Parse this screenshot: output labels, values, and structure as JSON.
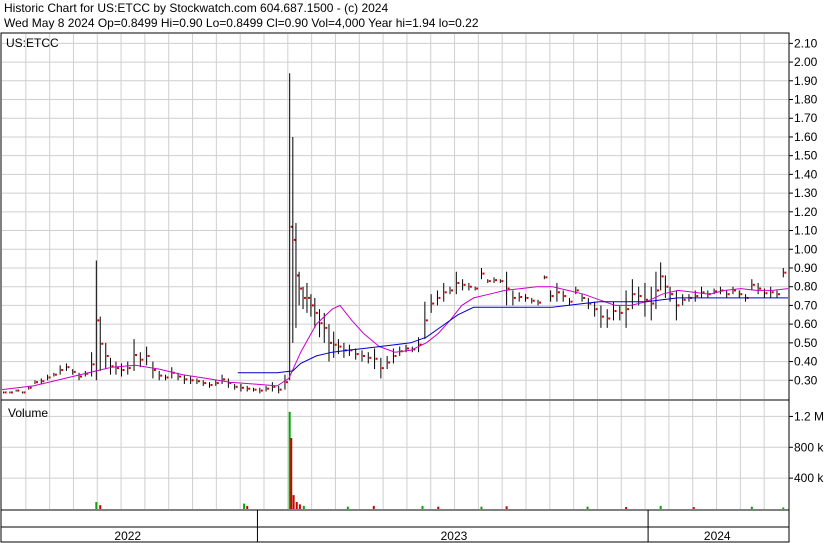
{
  "header": {
    "line1": "Historic Chart for US:ETCC by Stockwatch.com 604.687.1500 - (c) 2024",
    "line2": "Wed May  8 2024   Op=0.8499  Hi=0.90  Lo=0.8499  Cl=0.90  Vol=4,000  Year hi=1.94  lo=0.22"
  },
  "chart_data": {
    "type": "line",
    "price_panel_label": "US:ETCC",
    "volume_panel_label": "Volume",
    "price_axis": {
      "min": 0.2,
      "max": 2.15,
      "ticks": [
        "0.30",
        "0.40",
        "0.50",
        "0.60",
        "0.70",
        "0.80",
        "0.90",
        "1.00",
        "1.10",
        "1.20",
        "1.30",
        "1.40",
        "1.50",
        "1.60",
        "1.70",
        "1.80",
        "1.90",
        "2.00",
        "2.10"
      ]
    },
    "volume_axis": {
      "min": 0,
      "max": 1400000,
      "ticks": [
        {
          "v": 400000,
          "label": "400 k"
        },
        {
          "v": 800000,
          "label": "800 k"
        },
        {
          "v": 1200000,
          "label": "1.2 M"
        }
      ]
    },
    "year_labels": [
      "2022",
      "2023",
      "2024"
    ],
    "x_domain": [
      0,
      100
    ],
    "year_boundaries": [
      32.5,
      82.2
    ],
    "year_label_positions": [
      16.0,
      57.5,
      91.0
    ],
    "price_series": [
      {
        "x": 0.2,
        "h": 0.24,
        "l": 0.23
      },
      {
        "x": 1.0,
        "h": 0.24,
        "l": 0.23
      },
      {
        "x": 1.8,
        "h": 0.25,
        "l": 0.24
      },
      {
        "x": 2.6,
        "h": 0.24,
        "l": 0.23
      },
      {
        "x": 3.4,
        "h": 0.27,
        "l": 0.25
      },
      {
        "x": 4.2,
        "h": 0.3,
        "l": 0.28
      },
      {
        "x": 5.0,
        "h": 0.31,
        "l": 0.28
      },
      {
        "x": 5.8,
        "h": 0.33,
        "l": 0.3
      },
      {
        "x": 6.6,
        "h": 0.34,
        "l": 0.32
      },
      {
        "x": 7.4,
        "h": 0.38,
        "l": 0.33
      },
      {
        "x": 8.2,
        "h": 0.39,
        "l": 0.35
      },
      {
        "x": 9.0,
        "h": 0.36,
        "l": 0.33
      },
      {
        "x": 9.8,
        "h": 0.34,
        "l": 0.3
      },
      {
        "x": 10.6,
        "h": 0.35,
        "l": 0.32
      },
      {
        "x": 11.4,
        "h": 0.45,
        "l": 0.32
      },
      {
        "x": 12.0,
        "h": 0.94,
        "l": 0.3
      },
      {
        "x": 12.5,
        "h": 0.64,
        "l": 0.35
      },
      {
        "x": 13.2,
        "h": 0.5,
        "l": 0.36
      },
      {
        "x": 13.8,
        "h": 0.42,
        "l": 0.33
      },
      {
        "x": 14.5,
        "h": 0.4,
        "l": 0.33
      },
      {
        "x": 15.2,
        "h": 0.39,
        "l": 0.32
      },
      {
        "x": 16.0,
        "h": 0.4,
        "l": 0.33
      },
      {
        "x": 16.8,
        "h": 0.52,
        "l": 0.35
      },
      {
        "x": 17.6,
        "h": 0.45,
        "l": 0.37
      },
      {
        "x": 18.4,
        "h": 0.48,
        "l": 0.38
      },
      {
        "x": 19.2,
        "h": 0.4,
        "l": 0.31
      },
      {
        "x": 20.0,
        "h": 0.35,
        "l": 0.3
      },
      {
        "x": 20.8,
        "h": 0.33,
        "l": 0.3
      },
      {
        "x": 21.6,
        "h": 0.37,
        "l": 0.31
      },
      {
        "x": 22.4,
        "h": 0.34,
        "l": 0.3
      },
      {
        "x": 23.2,
        "h": 0.33,
        "l": 0.28
      },
      {
        "x": 24.0,
        "h": 0.32,
        "l": 0.28
      },
      {
        "x": 24.8,
        "h": 0.31,
        "l": 0.28
      },
      {
        "x": 25.6,
        "h": 0.3,
        "l": 0.27
      },
      {
        "x": 26.4,
        "h": 0.29,
        "l": 0.26
      },
      {
        "x": 27.2,
        "h": 0.3,
        "l": 0.27
      },
      {
        "x": 28.0,
        "h": 0.33,
        "l": 0.28
      },
      {
        "x": 28.8,
        "h": 0.31,
        "l": 0.26
      },
      {
        "x": 29.6,
        "h": 0.28,
        "l": 0.25
      },
      {
        "x": 30.4,
        "h": 0.28,
        "l": 0.24
      },
      {
        "x": 31.2,
        "h": 0.27,
        "l": 0.24
      },
      {
        "x": 32.0,
        "h": 0.26,
        "l": 0.24
      },
      {
        "x": 32.8,
        "h": 0.26,
        "l": 0.23
      },
      {
        "x": 33.6,
        "h": 0.27,
        "l": 0.24
      },
      {
        "x": 34.4,
        "h": 0.29,
        "l": 0.24
      },
      {
        "x": 35.2,
        "h": 0.27,
        "l": 0.23
      },
      {
        "x": 36.0,
        "h": 0.33,
        "l": 0.25
      },
      {
        "x": 36.6,
        "h": 1.94,
        "l": 0.3
      },
      {
        "x": 37.0,
        "h": 1.6,
        "l": 0.5
      },
      {
        "x": 37.4,
        "h": 1.14,
        "l": 0.58
      },
      {
        "x": 37.8,
        "h": 0.88,
        "l": 0.7
      },
      {
        "x": 38.3,
        "h": 0.8,
        "l": 0.68
      },
      {
        "x": 38.8,
        "h": 0.82,
        "l": 0.66
      },
      {
        "x": 39.3,
        "h": 0.76,
        "l": 0.64
      },
      {
        "x": 39.8,
        "h": 0.74,
        "l": 0.58
      },
      {
        "x": 40.4,
        "h": 0.68,
        "l": 0.53
      },
      {
        "x": 41.0,
        "h": 0.66,
        "l": 0.5
      },
      {
        "x": 41.6,
        "h": 0.6,
        "l": 0.4
      },
      {
        "x": 42.2,
        "h": 0.56,
        "l": 0.42
      },
      {
        "x": 42.8,
        "h": 0.52,
        "l": 0.44
      },
      {
        "x": 43.5,
        "h": 0.5,
        "l": 0.42
      },
      {
        "x": 44.2,
        "h": 0.49,
        "l": 0.43
      },
      {
        "x": 45.0,
        "h": 0.47,
        "l": 0.41
      },
      {
        "x": 45.8,
        "h": 0.46,
        "l": 0.4
      },
      {
        "x": 46.6,
        "h": 0.45,
        "l": 0.39
      },
      {
        "x": 47.4,
        "h": 0.47,
        "l": 0.36
      },
      {
        "x": 48.2,
        "h": 0.42,
        "l": 0.31
      },
      {
        "x": 49.0,
        "h": 0.43,
        "l": 0.36
      },
      {
        "x": 49.8,
        "h": 0.47,
        "l": 0.39
      },
      {
        "x": 50.6,
        "h": 0.48,
        "l": 0.43
      },
      {
        "x": 51.4,
        "h": 0.49,
        "l": 0.45
      },
      {
        "x": 52.2,
        "h": 0.48,
        "l": 0.45
      },
      {
        "x": 53.0,
        "h": 0.53,
        "l": 0.45
      },
      {
        "x": 53.8,
        "h": 0.72,
        "l": 0.52
      },
      {
        "x": 54.6,
        "h": 0.76,
        "l": 0.66
      },
      {
        "x": 55.4,
        "h": 0.78,
        "l": 0.7
      },
      {
        "x": 56.2,
        "h": 0.82,
        "l": 0.72
      },
      {
        "x": 57.0,
        "h": 0.8,
        "l": 0.76
      },
      {
        "x": 57.8,
        "h": 0.88,
        "l": 0.76
      },
      {
        "x": 58.6,
        "h": 0.84,
        "l": 0.78
      },
      {
        "x": 59.4,
        "h": 0.82,
        "l": 0.78
      },
      {
        "x": 60.2,
        "h": 0.8,
        "l": 0.78
      },
      {
        "x": 61.0,
        "h": 0.9,
        "l": 0.84
      },
      {
        "x": 61.8,
        "h": 0.84,
        "l": 0.82
      },
      {
        "x": 62.6,
        "h": 0.85,
        "l": 0.82
      },
      {
        "x": 63.4,
        "h": 0.84,
        "l": 0.82
      },
      {
        "x": 64.2,
        "h": 0.88,
        "l": 0.7
      },
      {
        "x": 65.0,
        "h": 0.78,
        "l": 0.7
      },
      {
        "x": 65.8,
        "h": 0.77,
        "l": 0.72
      },
      {
        "x": 66.6,
        "h": 0.76,
        "l": 0.72
      },
      {
        "x": 67.4,
        "h": 0.74,
        "l": 0.71
      },
      {
        "x": 68.2,
        "h": 0.73,
        "l": 0.7
      },
      {
        "x": 69.0,
        "h": 0.86,
        "l": 0.84
      },
      {
        "x": 69.8,
        "h": 0.78,
        "l": 0.72
      },
      {
        "x": 70.6,
        "h": 0.82,
        "l": 0.72
      },
      {
        "x": 71.4,
        "h": 0.78,
        "l": 0.72
      },
      {
        "x": 72.2,
        "h": 0.74,
        "l": 0.7
      },
      {
        "x": 73.0,
        "h": 0.8,
        "l": 0.76
      },
      {
        "x": 73.8,
        "h": 0.76,
        "l": 0.72
      },
      {
        "x": 74.6,
        "h": 0.74,
        "l": 0.68
      },
      {
        "x": 75.4,
        "h": 0.72,
        "l": 0.64
      },
      {
        "x": 76.2,
        "h": 0.7,
        "l": 0.58
      },
      {
        "x": 77.0,
        "h": 0.68,
        "l": 0.58
      },
      {
        "x": 77.8,
        "h": 0.72,
        "l": 0.62
      },
      {
        "x": 78.6,
        "h": 0.7,
        "l": 0.62
      },
      {
        "x": 79.4,
        "h": 0.78,
        "l": 0.58
      },
      {
        "x": 80.2,
        "h": 0.84,
        "l": 0.68
      },
      {
        "x": 81.0,
        "h": 0.8,
        "l": 0.7
      },
      {
        "x": 81.8,
        "h": 0.82,
        "l": 0.64
      },
      {
        "x": 82.6,
        "h": 0.8,
        "l": 0.62
      },
      {
        "x": 83.2,
        "h": 0.88,
        "l": 0.68
      },
      {
        "x": 83.8,
        "h": 0.93,
        "l": 0.78
      },
      {
        "x": 84.4,
        "h": 0.86,
        "l": 0.74
      },
      {
        "x": 85.0,
        "h": 0.8,
        "l": 0.72
      },
      {
        "x": 85.8,
        "h": 0.78,
        "l": 0.62
      },
      {
        "x": 86.6,
        "h": 0.76,
        "l": 0.7
      },
      {
        "x": 87.4,
        "h": 0.76,
        "l": 0.72
      },
      {
        "x": 88.2,
        "h": 0.78,
        "l": 0.72
      },
      {
        "x": 89.0,
        "h": 0.8,
        "l": 0.74
      },
      {
        "x": 89.8,
        "h": 0.78,
        "l": 0.74
      },
      {
        "x": 90.6,
        "h": 0.79,
        "l": 0.76
      },
      {
        "x": 91.4,
        "h": 0.8,
        "l": 0.76
      },
      {
        "x": 92.2,
        "h": 0.78,
        "l": 0.74
      },
      {
        "x": 93.0,
        "h": 0.8,
        "l": 0.76
      },
      {
        "x": 93.8,
        "h": 0.78,
        "l": 0.74
      },
      {
        "x": 94.6,
        "h": 0.76,
        "l": 0.72
      },
      {
        "x": 95.4,
        "h": 0.84,
        "l": 0.78
      },
      {
        "x": 96.2,
        "h": 0.82,
        "l": 0.76
      },
      {
        "x": 97.0,
        "h": 0.79,
        "l": 0.74
      },
      {
        "x": 97.8,
        "h": 0.8,
        "l": 0.74
      },
      {
        "x": 98.6,
        "h": 0.78,
        "l": 0.74
      },
      {
        "x": 99.4,
        "h": 0.9,
        "l": 0.85
      }
    ],
    "ma_short": {
      "color": "#cc00cc",
      "points": [
        [
          0,
          0.25
        ],
        [
          4,
          0.27
        ],
        [
          8,
          0.31
        ],
        [
          12,
          0.35
        ],
        [
          14,
          0.37
        ],
        [
          17,
          0.38
        ],
        [
          20,
          0.36
        ],
        [
          23,
          0.33
        ],
        [
          26,
          0.31
        ],
        [
          29,
          0.29
        ],
        [
          32,
          0.28
        ],
        [
          35,
          0.27
        ],
        [
          36.5,
          0.31
        ],
        [
          38,
          0.45
        ],
        [
          40,
          0.6
        ],
        [
          42,
          0.68
        ],
        [
          43,
          0.7
        ],
        [
          44.5,
          0.62
        ],
        [
          46,
          0.55
        ],
        [
          48,
          0.48
        ],
        [
          50,
          0.45
        ],
        [
          52,
          0.46
        ],
        [
          54,
          0.5
        ],
        [
          55.5,
          0.55
        ],
        [
          57,
          0.62
        ],
        [
          58.5,
          0.7
        ],
        [
          60,
          0.74
        ],
        [
          62,
          0.76
        ],
        [
          64,
          0.78
        ],
        [
          66,
          0.79
        ],
        [
          68,
          0.8
        ],
        [
          70,
          0.8
        ],
        [
          72,
          0.78
        ],
        [
          74,
          0.76
        ],
        [
          76,
          0.73
        ],
        [
          78,
          0.7
        ],
        [
          80,
          0.7
        ],
        [
          82,
          0.72
        ],
        [
          84,
          0.76
        ],
        [
          86,
          0.78
        ],
        [
          88,
          0.77
        ],
        [
          90,
          0.76
        ],
        [
          92,
          0.78
        ],
        [
          94,
          0.79
        ],
        [
          96,
          0.78
        ],
        [
          98,
          0.78
        ],
        [
          100,
          0.79
        ]
      ]
    },
    "ma_long": {
      "color": "#0000cc",
      "points": [
        [
          30,
          0.34
        ],
        [
          33,
          0.34
        ],
        [
          35,
          0.34
        ],
        [
          37,
          0.35
        ],
        [
          38,
          0.39
        ],
        [
          40,
          0.43
        ],
        [
          42,
          0.45
        ],
        [
          44,
          0.46
        ],
        [
          46,
          0.47
        ],
        [
          48,
          0.48
        ],
        [
          50,
          0.49
        ],
        [
          52,
          0.5
        ],
        [
          54,
          0.53
        ],
        [
          56,
          0.59
        ],
        [
          58,
          0.65
        ],
        [
          60,
          0.69
        ],
        [
          62,
          0.69
        ],
        [
          64,
          0.69
        ],
        [
          66,
          0.69
        ],
        [
          68,
          0.69
        ],
        [
          70,
          0.69
        ],
        [
          72,
          0.7
        ],
        [
          74,
          0.71
        ],
        [
          76,
          0.72
        ],
        [
          78,
          0.72
        ],
        [
          80,
          0.72
        ],
        [
          82,
          0.72
        ],
        [
          84,
          0.73
        ],
        [
          86,
          0.74
        ],
        [
          88,
          0.74
        ],
        [
          90,
          0.74
        ],
        [
          92,
          0.74
        ],
        [
          94,
          0.74
        ],
        [
          96,
          0.74
        ],
        [
          98,
          0.74
        ],
        [
          100,
          0.74
        ]
      ]
    },
    "volume_series": [
      {
        "x": 12.0,
        "v": 90000,
        "c": "#00aa00"
      },
      {
        "x": 12.5,
        "v": 50000,
        "c": "#cc0000"
      },
      {
        "x": 30.8,
        "v": 70000,
        "c": "#00aa00"
      },
      {
        "x": 31.2,
        "v": 40000,
        "c": "#cc0000"
      },
      {
        "x": 36.6,
        "v": 1260000,
        "c": "#00aa00"
      },
      {
        "x": 36.8,
        "v": 920000,
        "c": "#cc0000"
      },
      {
        "x": 37.1,
        "v": 180000,
        "c": "#cc0000"
      },
      {
        "x": 37.5,
        "v": 90000,
        "c": "#cc0000"
      },
      {
        "x": 37.9,
        "v": 60000,
        "c": "#cc0000"
      },
      {
        "x": 38.4,
        "v": 40000,
        "c": "#00aa00"
      },
      {
        "x": 44.0,
        "v": 30000,
        "c": "#00aa00"
      },
      {
        "x": 47.3,
        "v": 40000,
        "c": "#cc0000"
      },
      {
        "x": 53.5,
        "v": 40000,
        "c": "#00aa00"
      },
      {
        "x": 55.5,
        "v": 30000,
        "c": "#cc0000"
      },
      {
        "x": 61.0,
        "v": 30000,
        "c": "#00aa00"
      },
      {
        "x": 64.2,
        "v": 35000,
        "c": "#cc0000"
      },
      {
        "x": 74.5,
        "v": 30000,
        "c": "#00aa00"
      },
      {
        "x": 79.4,
        "v": 25000,
        "c": "#cc0000"
      },
      {
        "x": 83.8,
        "v": 40000,
        "c": "#00aa00"
      },
      {
        "x": 88.0,
        "v": 25000,
        "c": "#cc0000"
      },
      {
        "x": 95.4,
        "v": 30000,
        "c": "#00aa00"
      },
      {
        "x": 99.4,
        "v": 20000,
        "c": "#00aa00"
      }
    ]
  }
}
